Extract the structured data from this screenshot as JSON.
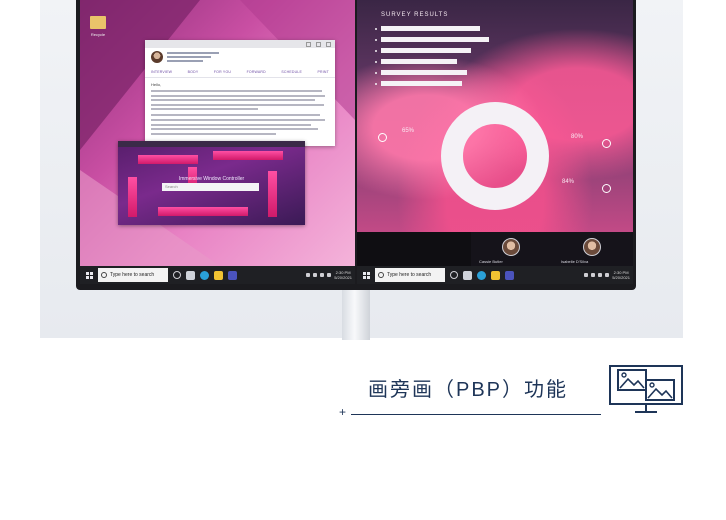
{
  "left_screen": {
    "desktop_icon_label": "Recycle",
    "mail": {
      "tabs": [
        "INTERVIEW",
        "BODY",
        "FOR YOU",
        "FORWARD",
        "SCHEDULE",
        "PRINT"
      ],
      "greeting": "Hello,"
    },
    "game": {
      "title": "Immersive Window Controller",
      "input_placeholder": "Search"
    },
    "taskbar": {
      "search_placeholder": "Type here to search",
      "time": "2:30 PM",
      "date": "5/20/2021"
    }
  },
  "right_screen": {
    "survey": {
      "title": "SURVEY RESULTS",
      "bars": [
        0.55,
        0.6,
        0.5,
        0.42,
        0.48,
        0.45
      ],
      "donut_ring_fraction": 1.0,
      "percentages": [
        "65%",
        "80%",
        "84%"
      ]
    },
    "participants": [
      {
        "name": "Cassie Butler"
      },
      {
        "name": "Isabelle D'Silva"
      }
    ],
    "taskbar": {
      "search_placeholder": "Type here to search",
      "time": "2:30 PM",
      "date": "5/20/2021"
    }
  },
  "caption": {
    "headline": "画旁画（PBP）功能",
    "plus": "+"
  },
  "icons": {
    "pbp": "pbp-monitor-icon",
    "start": "windows-start-icon",
    "search": "search-icon"
  },
  "colors": {
    "headline": "#1e3558",
    "taskbar": "#1f2024"
  }
}
